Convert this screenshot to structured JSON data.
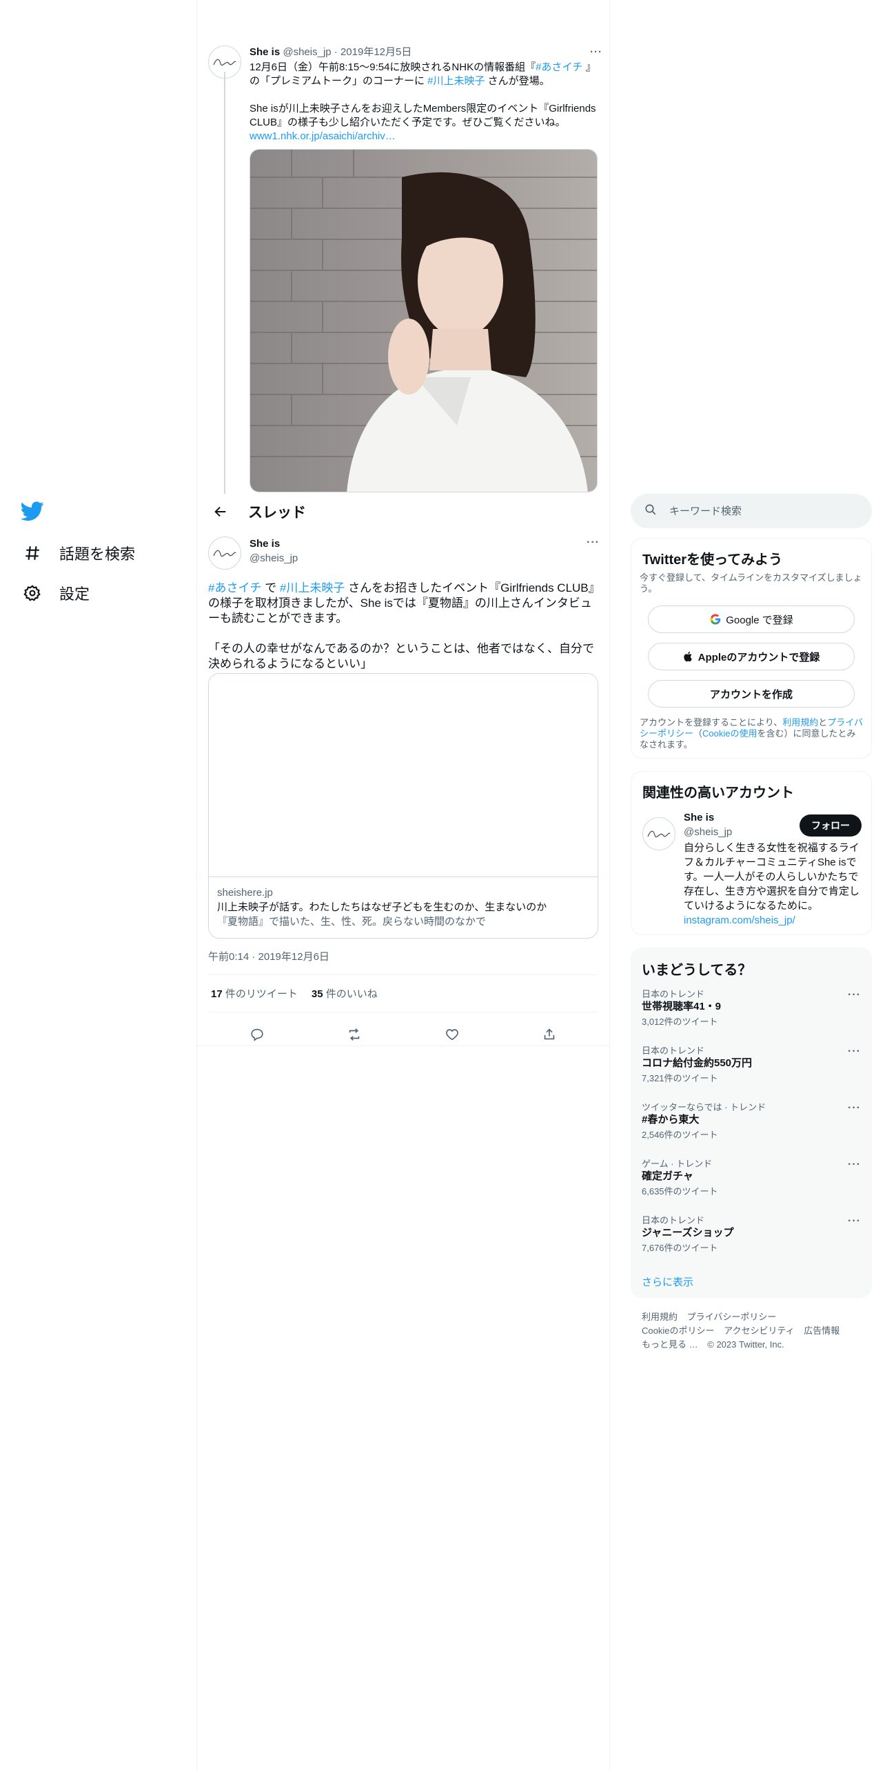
{
  "nav": {
    "logo": "twitter-bird-icon",
    "items": [
      {
        "label": "話題を検索",
        "icon": "hashtag-icon"
      },
      {
        "label": "設定",
        "icon": "gear-icon"
      }
    ]
  },
  "prev_tweet": {
    "name": "She is",
    "handle": "@sheis_jp",
    "sep": "·",
    "date": "2019年12月5日",
    "line1a": "12月6日（金）午前8:15〜9:54に放映されるNHKの情報番組『",
    "tag1": "#あさイチ",
    "line1b": " 』",
    "line2a": "の「プレミアムトーク」のコーナーに ",
    "tag2": "#川上未映子",
    "line2b": " さんが登場。",
    "para2": "She isが川上未映子さんをお迎えしたMembers限定のイベント『Girlfriends CLUB』の様子も少し紹介いただく予定です。ぜひご覧くださいね。",
    "link": "www1.nhk.or.jp/asaichi/archiv…"
  },
  "thread_header": {
    "title": "スレッド"
  },
  "main_tweet": {
    "name": "She is",
    "handle": "@sheis_jp",
    "tag1": "#あさイチ",
    "t1": " で ",
    "tag2": "#川上未映子",
    "t2": " さんをお招きしたイベント『Girlfriends CLUB』の様子を取材頂きましたが、She isでは『夏物語』の川上さんインタビューも読むことができます。",
    "quote": "「その人の幸せがなんであるのか？ということは、他者ではなく、自分で決められるようになるといい」",
    "card": {
      "domain": "sheishere.jp",
      "title": "川上未映子が話す。わたしたちはなぜ子どもを生むのか、生まないのか",
      "desc": "『夏物語』で描いた、生、性、死。戻らない時間のなかで"
    },
    "timestamp": "午前0:14 · 2019年12月6日",
    "retweets_count": "17",
    "retweets_label": "件のリツイート",
    "likes_count": "35",
    "likes_label": "件のいいね"
  },
  "search": {
    "placeholder": "キーワード検索"
  },
  "signup": {
    "title": "Twitterを使ってみよう",
    "sub": "今すぐ登録して、タイムラインをカスタマイズしましょう。",
    "google": "Google で登録",
    "apple": "Appleのアカウントで登録",
    "create": "アカウントを作成",
    "legal_a": "アカウントを登録することにより、",
    "legal_terms": "利用規約",
    "legal_b": "と",
    "legal_privacy": "プライバシーポリシー",
    "legal_c": "（",
    "legal_cookie": "Cookieの使用",
    "legal_d": "を含む）に同意したとみなされます。"
  },
  "related": {
    "title": "関連性の高いアカウント",
    "name": "She is",
    "handle": "@sheis_jp",
    "follow": "フォロー",
    "bio": "自分らしく生きる女性を祝福するライフ＆カルチャーコミュニティShe isです。一人一人がその人らしいかたちで存在し、生き方や選択を自分で肯定していけるようになるために。",
    "link": "instagram.com/sheis_jp/"
  },
  "trends": {
    "title": "いまどうしてる？",
    "items": [
      {
        "context": "日本のトレンド",
        "name": "世帯視聴率41・9",
        "count": "3,012件のツイート"
      },
      {
        "context": "日本のトレンド",
        "name": "コロナ給付金約550万円",
        "count": "7,321件のツイート"
      },
      {
        "context": "ツイッターならでは · トレンド",
        "name": "#春から東大",
        "count": "2,546件のツイート"
      },
      {
        "context": "ゲーム · トレンド",
        "name": "確定ガチャ",
        "count": "6,635件のツイート"
      },
      {
        "context": "日本のトレンド",
        "name": "ジャニーズショップ",
        "count": "7,676件のツイート"
      }
    ],
    "more": "さらに表示"
  },
  "footer": {
    "terms": "利用規約",
    "privacy": "プライバシーポリシー",
    "cookie": "Cookieのポリシー",
    "accessibility": "アクセシビリティ",
    "ads": "広告情報",
    "more": "もっと見る …",
    "copyright": "© 2023 Twitter, Inc."
  },
  "colors": {
    "accent": "#1d9bf0",
    "text": "#0f1419",
    "muted": "#536471"
  }
}
